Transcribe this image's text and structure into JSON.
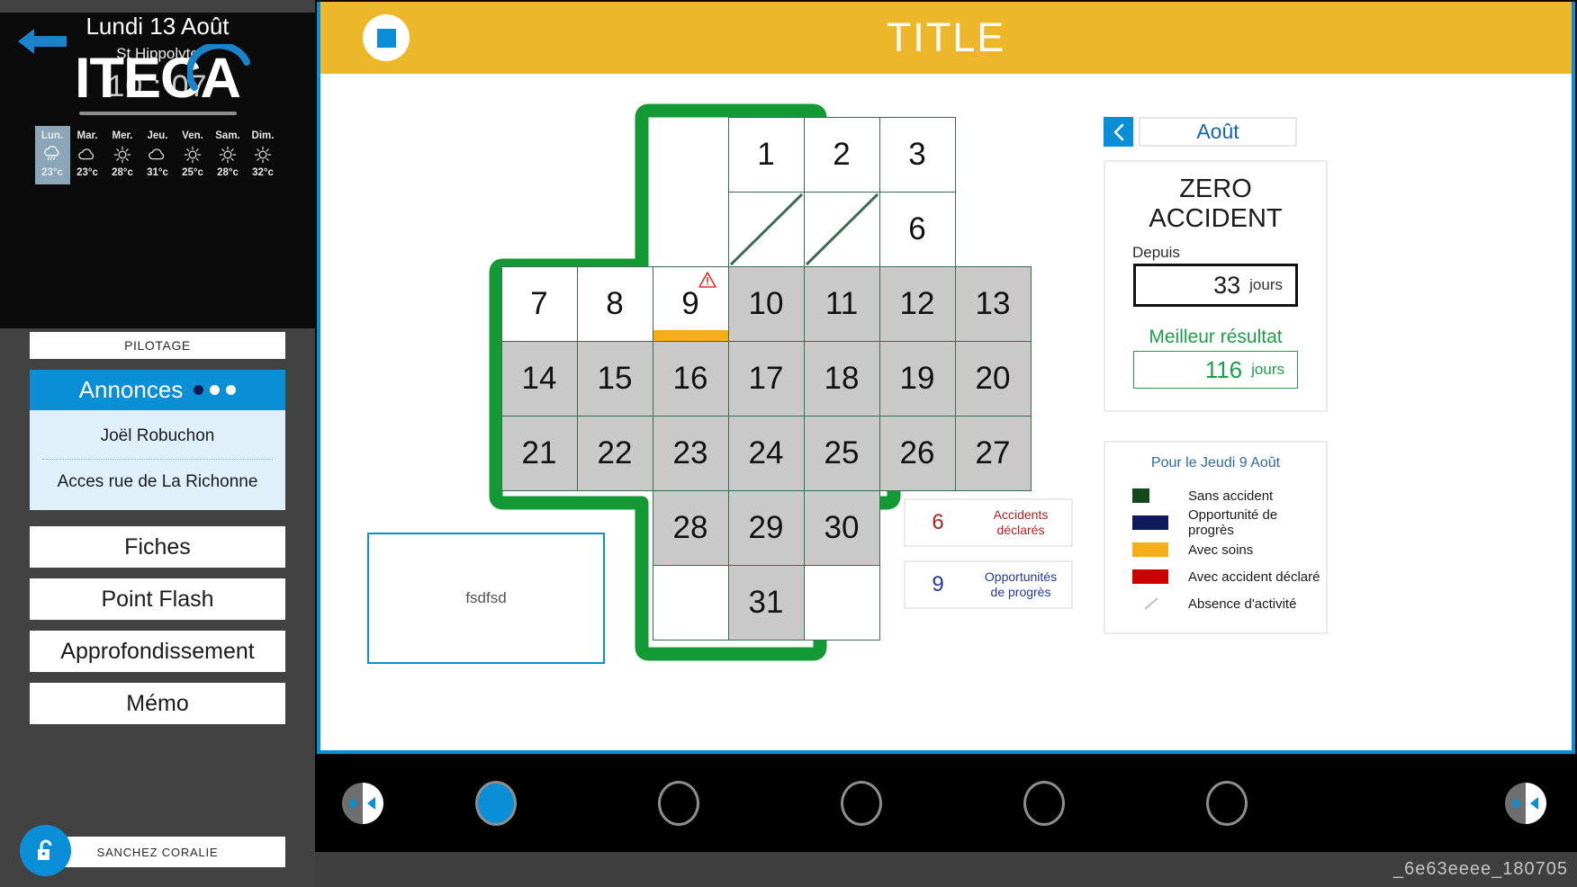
{
  "sidebar": {
    "back_icon": "back-arrow-icon",
    "logo_text": "ITECA",
    "date": "Lundi 13 Août",
    "city": "St Hippolyte",
    "time": "10 : 07",
    "weather": [
      {
        "day": "Lun.",
        "icon": "rain-icon",
        "temp": "23°c",
        "active": true
      },
      {
        "day": "Mar.",
        "icon": "cloud-icon",
        "temp": "23°c",
        "active": false
      },
      {
        "day": "Mer.",
        "icon": "sun-icon",
        "temp": "28°c",
        "active": false
      },
      {
        "day": "Jeu.",
        "icon": "cloud-icon",
        "temp": "31°c",
        "active": false
      },
      {
        "day": "Ven.",
        "icon": "sun-icon",
        "temp": "25°c",
        "active": false
      },
      {
        "day": "Sam.",
        "icon": "sun-icon",
        "temp": "28°c",
        "active": false
      },
      {
        "day": "Dim.",
        "icon": "sun-icon",
        "temp": "32°c",
        "active": false
      }
    ],
    "pilotage_label": "PILOTAGE",
    "annonces": {
      "title": "Annonces",
      "dots": 3,
      "current_dot": 0,
      "items": [
        "Joël Robuchon",
        "Acces rue de La Richonne"
      ]
    },
    "menu": [
      "Fiches",
      "Point Flash",
      "Approfondissement",
      "Mémo"
    ],
    "user_name": "SANCHEZ CORALIE",
    "lock_icon": "unlock-icon"
  },
  "titlebar": {
    "stop_icon": "stop-square-icon",
    "title": "TITLE"
  },
  "calendar": {
    "note_text": "fsdfsd",
    "warning_icon": "warning-triangle-icon",
    "rows": [
      [
        {
          "t": "empty"
        },
        {
          "t": "empty"
        },
        {
          "t": "empty"
        },
        {
          "num": "1",
          "state": "past"
        },
        {
          "num": "2",
          "state": "past"
        },
        {
          "num": "3",
          "state": "past"
        },
        {
          "t": "empty"
        }
      ],
      [
        {
          "t": "empty"
        },
        {
          "t": "empty"
        },
        {
          "t": "empty"
        },
        {
          "num": "",
          "state": "past",
          "slash": true
        },
        {
          "num": "",
          "state": "past",
          "slash": true
        },
        {
          "num": "6",
          "state": "past"
        },
        {
          "t": "empty"
        }
      ],
      [
        {
          "num": "7",
          "state": "past"
        },
        {
          "num": "8",
          "state": "past"
        },
        {
          "num": "9",
          "state": "past",
          "warn": true,
          "strip": "#f5ad18"
        },
        {
          "num": "10",
          "state": "future"
        },
        {
          "num": "11",
          "state": "future"
        },
        {
          "num": "12",
          "state": "future"
        },
        {
          "num": "13",
          "state": "future"
        }
      ],
      [
        {
          "num": "14",
          "state": "future"
        },
        {
          "num": "15",
          "state": "future"
        },
        {
          "num": "16",
          "state": "future"
        },
        {
          "num": "17",
          "state": "future"
        },
        {
          "num": "18",
          "state": "future"
        },
        {
          "num": "19",
          "state": "future"
        },
        {
          "num": "20",
          "state": "future"
        }
      ],
      [
        {
          "num": "21",
          "state": "future"
        },
        {
          "num": "22",
          "state": "future"
        },
        {
          "num": "23",
          "state": "future"
        },
        {
          "num": "24",
          "state": "future"
        },
        {
          "num": "25",
          "state": "future"
        },
        {
          "num": "26",
          "state": "future"
        },
        {
          "num": "27",
          "state": "future"
        }
      ],
      [
        {
          "t": "empty"
        },
        {
          "t": "empty"
        },
        {
          "num": "28",
          "state": "future"
        },
        {
          "num": "29",
          "state": "future"
        },
        {
          "num": "30",
          "state": "future"
        },
        {
          "t": "empty"
        },
        {
          "t": "empty"
        }
      ],
      [
        {
          "t": "empty"
        },
        {
          "t": "empty"
        },
        {
          "num": "",
          "state": "blank"
        },
        {
          "num": "31",
          "state": "future"
        },
        {
          "num": "",
          "state": "blank"
        },
        {
          "t": "empty"
        },
        {
          "t": "empty"
        }
      ]
    ]
  },
  "month_nav": {
    "prev_icon": "chevron-left-icon",
    "month": "Août"
  },
  "zero_panel": {
    "title_line1": "ZERO",
    "title_line2": "ACCIDENT",
    "depuis_label": "Depuis",
    "depuis_value": "33",
    "depuis_unit": "jours",
    "best_label": "Meilleur résultat",
    "best_value": "116",
    "best_unit": "jours"
  },
  "legend": {
    "title": "Pour le Jeudi 9 Août",
    "rows": [
      {
        "color": "#13491a",
        "label": "Sans accident",
        "shape": "square"
      },
      {
        "color": "#0d1a5c",
        "label": "Opportunité de progrès",
        "shape": "bar"
      },
      {
        "color": "#f5ad18",
        "label": "Avec soins",
        "shape": "bar"
      },
      {
        "color": "#cc0000",
        "label": "Avec accident déclaré",
        "shape": "bar"
      },
      {
        "color": "#bdbdbd",
        "label": "Absence d'activité",
        "shape": "slash"
      }
    ]
  },
  "stats": [
    {
      "value": "6",
      "line1": "Accidents",
      "line2": "déclarés",
      "color": "#b22020"
    },
    {
      "value": "9",
      "line1": "Opportunités",
      "line2": "de progrès",
      "color": "#22399c"
    }
  ],
  "bottombar": {
    "prev_icon": "pager-prev-icon",
    "next_icon": "pager-next-icon",
    "circles": [
      {
        "active": true
      },
      {
        "active": false
      },
      {
        "active": false
      },
      {
        "active": false
      },
      {
        "active": false
      }
    ]
  },
  "footer": {
    "label": "_6e63eeee_180705"
  },
  "colors": {
    "accent_blue": "#0a8fd6",
    "title_yellow": "#edb72c",
    "cross_green": "#149a34",
    "grid_green": "#3c6b52"
  }
}
